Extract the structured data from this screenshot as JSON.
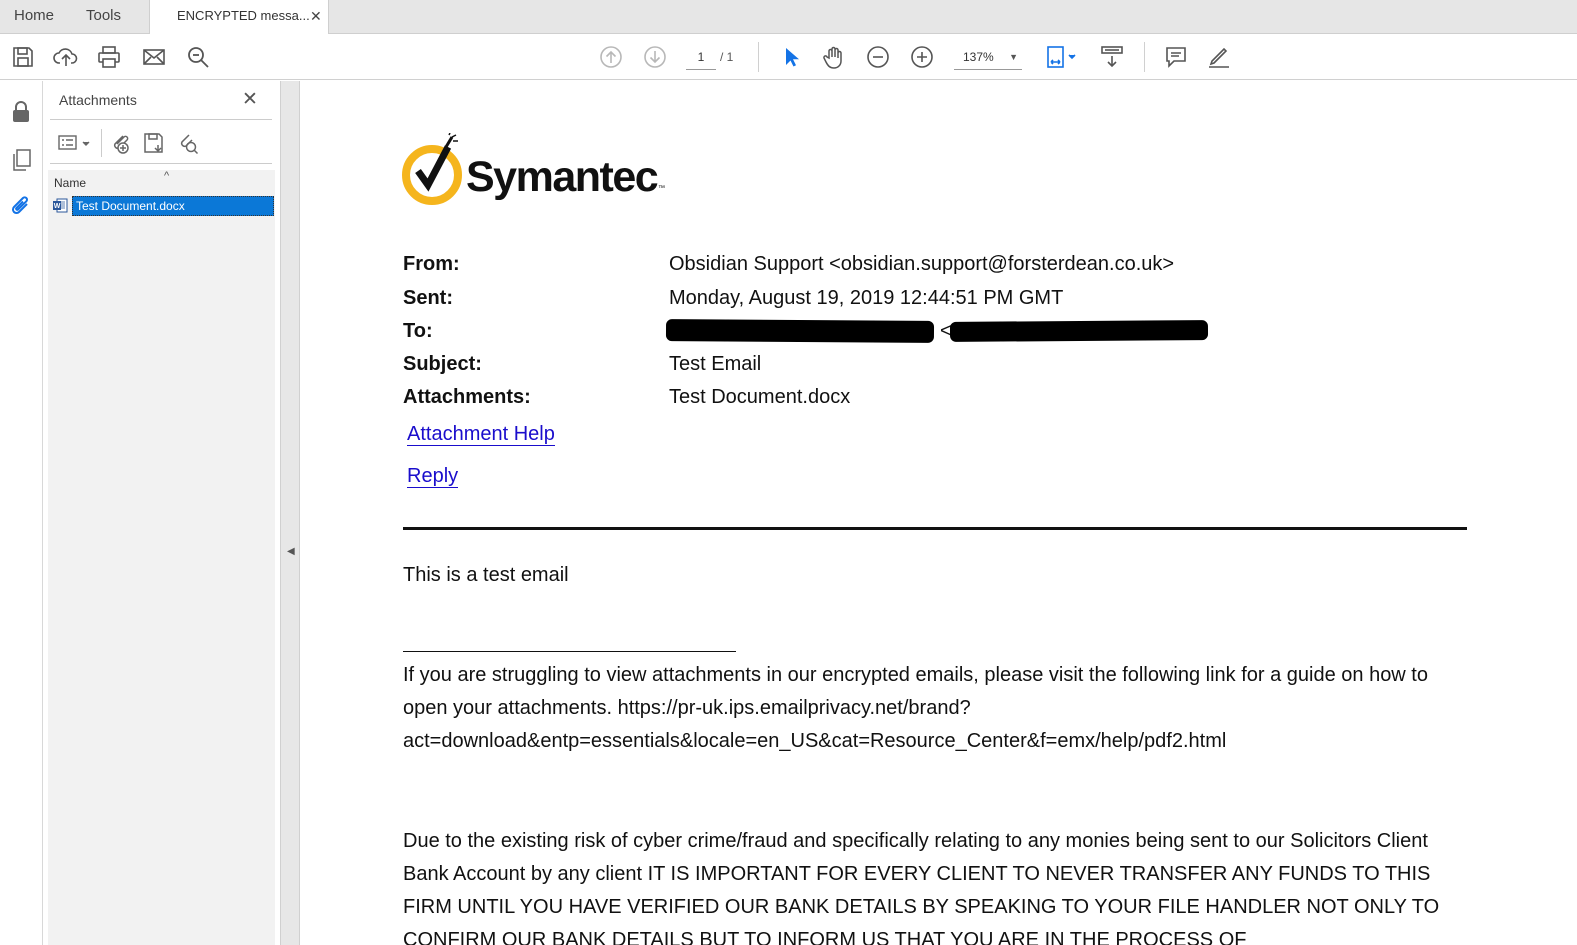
{
  "tabs": {
    "home": "Home",
    "tools": "Tools",
    "document": "ENCRYPTED messa...",
    "close_symbol": "✕"
  },
  "toolbar": {
    "page_current": "1",
    "page_total": "/ 1",
    "zoom": "137%",
    "icons": [
      "save-icon",
      "upload-icon",
      "print-icon",
      "email-icon",
      "search-icon",
      "previous-page-icon",
      "next-page-icon",
      "select-cursor-icon",
      "hand-icon",
      "zoom-out-icon",
      "zoom-in-icon",
      "fit-page-icon",
      "scroll-mode-icon",
      "comment-icon",
      "sign-icon"
    ]
  },
  "rail": {
    "icons": [
      "lock-icon",
      "pages-icon",
      "attachment-icon"
    ]
  },
  "attachments_panel": {
    "title": "Attachments",
    "column_name": "Name",
    "files": [
      {
        "name": "Test Document.docx",
        "selected": true
      }
    ]
  },
  "email": {
    "logo_text": "Symantec",
    "logo_tm": "™",
    "headers": [
      {
        "label": "From:",
        "value": "Obsidian Support <obsidian.support@forsterdean.co.uk>"
      },
      {
        "label": "Sent:",
        "value": "Monday, August 19, 2019 12:44:51 PM GMT"
      },
      {
        "label": "To:",
        "value": "<",
        "redacted": true
      },
      {
        "label": "Subject:",
        "value": "Test Email"
      },
      {
        "label": "Attachments:",
        "value": "Test Document.docx"
      }
    ],
    "links": {
      "attachment_help": "Attachment Help",
      "reply": "Reply"
    },
    "body": "This is a test email",
    "footer_paragraph_1": "If you are struggling to view attachments in our encrypted emails, please visit the following link for a guide on how to open your attachments. https://pr-uk.ips.emailprivacy.net/brand?act=download&entp=essentials&locale=en_US&cat=Resource_Center&f=emx/help/pdf2.html",
    "footer_paragraph_2": "Due to the existing risk of cyber crime/fraud and specifically relating to any monies being sent to our Solicitors Client Bank Account by any client IT IS IMPORTANT FOR EVERY CLIENT TO NEVER TRANSFER ANY FUNDS TO THIS FIRM UNTIL YOU HAVE VERIFIED OUR BANK DETAILS BY SPEAKING TO YOUR FILE HANDLER NOT ONLY TO CONFIRM OUR BANK DETAILS BUT TO INFORM US THAT YOU ARE IN THE PROCESS OF"
  },
  "colors": {
    "accent": "#1473e6",
    "selection": "#0b78d7",
    "link": "#1a0dcc",
    "logo_yellow": "#f5b51d"
  }
}
